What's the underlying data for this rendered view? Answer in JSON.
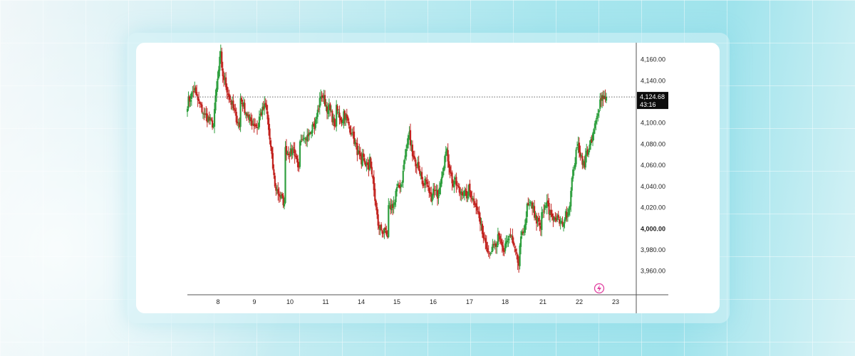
{
  "chart_data": {
    "type": "candlestick",
    "y_ticks": [
      "4,160.00",
      "4,140.00",
      "4,120.00",
      "4,100.00",
      "4,080.00",
      "4,060.00",
      "4,040.00",
      "4,020.00",
      "4,000.00",
      "3,980.00",
      "3,960.00"
    ],
    "ylim": [
      3946,
      4172
    ],
    "x_ticks": [
      "8",
      "9",
      "10",
      "11",
      "14",
      "15",
      "16",
      "17",
      "18",
      "21",
      "22",
      "23"
    ],
    "last_price": 4124.68,
    "last_price_label": "4,124.68",
    "countdown_label": "43:16",
    "grid": false,
    "colors": {
      "up": "#2e9f3e",
      "down": "#c2231f",
      "label_bg": "#0c0c0c",
      "badge": "#e040a0"
    },
    "segments": [
      [
        4118,
        4133
      ],
      [
        4128,
        4108,
        4098
      ],
      [
        4104,
        4168
      ],
      [
        4152,
        4122,
        4096
      ],
      [
        4126,
        4103,
        4096
      ],
      [
        4104,
        4117
      ],
      [
        4120,
        4040,
        4024
      ],
      [
        4075,
        4071
      ],
      [
        4082,
        4058
      ],
      [
        4078,
        4084
      ],
      [
        4089,
        4099
      ],
      [
        4092,
        4125
      ],
      [
        4130,
        4112
      ],
      [
        4116,
        4097
      ],
      [
        4115,
        4101
      ],
      [
        4113,
        4090,
        4061
      ],
      [
        4069,
        4056
      ],
      [
        4077,
        4003,
        3992
      ],
      [
        4018,
        4025
      ],
      [
        4034,
        4044
      ],
      [
        4052,
        4092
      ],
      [
        4084,
        4058
      ],
      [
        4064,
        4041
      ],
      [
        4048,
        4026
      ],
      [
        4037,
        4032
      ],
      [
        4037,
        4073
      ],
      [
        4077,
        4040
      ],
      [
        4048,
        4033
      ],
      [
        4037,
        4031
      ],
      [
        4040,
        4023
      ],
      [
        4029,
        3995
      ],
      [
        3998,
        3976
      ],
      [
        3980,
        3984
      ],
      [
        3994,
        3978
      ],
      [
        3986,
        3993
      ],
      [
        3989,
        3965
      ],
      [
        3980,
        4010
      ],
      [
        4020,
        4022
      ],
      [
        4015,
        4000
      ],
      [
        4012,
        4024
      ],
      [
        4017,
        4009
      ],
      [
        4011,
        4003
      ],
      [
        4006,
        4022
      ],
      [
        4034,
        4077
      ],
      [
        4082,
        4058
      ],
      [
        4067,
        4082
      ],
      [
        4086,
        4112
      ],
      [
        4126,
        4124.68
      ]
    ]
  }
}
